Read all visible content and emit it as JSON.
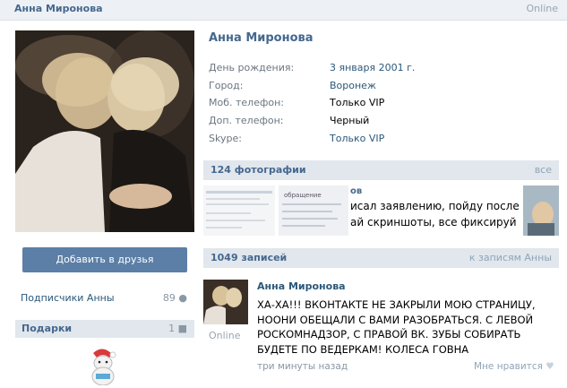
{
  "header": {
    "name": "Анна Миронова",
    "status": "Online"
  },
  "profile": {
    "name": "Анна Миронова",
    "rows": [
      {
        "label": "День рождения:",
        "value": "3 января 2001 г."
      },
      {
        "label": "Город:",
        "value": "Воронеж"
      },
      {
        "label": "Моб. телефон:",
        "value": "Только VIP"
      },
      {
        "label": "Доп. телефон:",
        "value": "Черный"
      },
      {
        "label": "Skype:",
        "value": "Только VIP"
      }
    ]
  },
  "sidebar": {
    "add_friend": "Добавить в друзья",
    "subscribers_label": "Подписчики Анны",
    "subscribers_count": "89",
    "gifts_label": "Подарки",
    "gifts_count": "1"
  },
  "photos": {
    "title": "124 фотографии",
    "all_link": "все",
    "snippet_line1": "исал заявлению, пойду после ра",
    "snippet_line2": "ай скриншоты, все фиксируй",
    "snippet_tag": "ов",
    "mini_text": "обращение"
  },
  "wall": {
    "title": "1049 записей",
    "link": "к записям Анны"
  },
  "post": {
    "author": "Анна Миронова",
    "online": "Online",
    "text": "ХА-ХА!!! ВКОНТАКТЕ НЕ ЗАКРЫЛИ МОЮ СТРАНИЦУ, НООНИ ОБЕЩАЛИ С ВАМИ РАЗОБРАТЬСЯ. С ЛЕВОЙ РОСКОМНАДЗОР, С ПРАВОЙ ВК. ЗУБЫ СОБИРАТЬ БУДЕТЕ ПО ВЕДЕРКАМ! КОЛЕСА ГОВНА",
    "time": "три минуты назад",
    "like": "Мне нравится"
  },
  "colors": {
    "link": "#2b587a",
    "header_text": "#45688e",
    "button": "#5b7fa6",
    "section_bg": "#e1e7ed"
  }
}
